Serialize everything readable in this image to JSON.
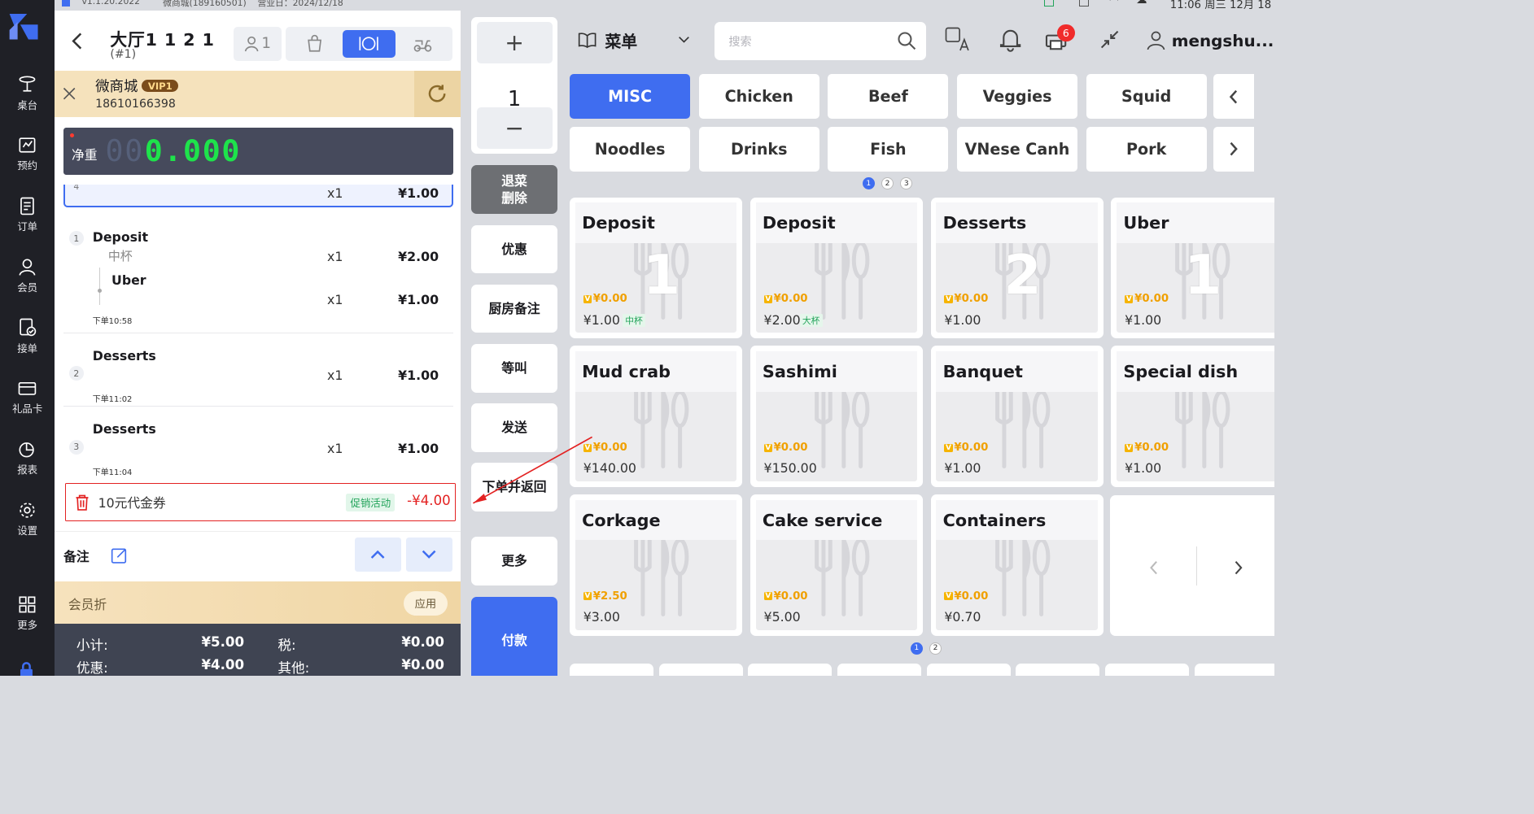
{
  "app": {
    "version": "v1.1.20.2022",
    "store": "微商城(189160501)",
    "business_day": "营业日：2024/12/18"
  },
  "sidebar": {
    "items": [
      {
        "label": "桌台",
        "icon": "table-icon"
      },
      {
        "label": "预约",
        "icon": "reservation-icon"
      },
      {
        "label": "订单",
        "icon": "order-icon"
      },
      {
        "label": "会员",
        "icon": "member-icon"
      },
      {
        "label": "接单",
        "icon": "accept-order-icon"
      },
      {
        "label": "礼品卡",
        "icon": "gift-card-icon"
      },
      {
        "label": "报表",
        "icon": "report-icon"
      },
      {
        "label": "设置",
        "icon": "settings-icon"
      },
      {
        "label": "更多",
        "icon": "more-icon"
      }
    ]
  },
  "order": {
    "table": "大厅1 1 2 1",
    "sub": "(#1)",
    "guests": "1",
    "member": {
      "name": "微商城",
      "level": "VIP1",
      "phone": "18610166398"
    },
    "scale": {
      "label": "净重",
      "ghost": "00",
      "value": "0.000"
    },
    "items": [
      {
        "num": "4",
        "qty": "x1",
        "price": "¥1.00"
      },
      {
        "num": "1",
        "name": "Deposit",
        "variant": "中杯",
        "qty": "x1",
        "price": "¥2.00",
        "sub": {
          "name": "Uber",
          "qty": "x1",
          "price": "¥1.00"
        },
        "time": "下单10:58"
      },
      {
        "num": "2",
        "name": "Desserts",
        "qty": "x1",
        "price": "¥1.00",
        "time": "下单11:02"
      },
      {
        "num": "3",
        "name": "Desserts",
        "qty": "x1",
        "price": "¥1.00",
        "time": "下单11:04"
      }
    ],
    "coupon": {
      "text": "10元代金券",
      "tag": "促销活动",
      "amount": "-¥4.00"
    },
    "note_label": "备注",
    "member_discount": {
      "label": "会员折",
      "apply": "应用"
    },
    "totals": {
      "subtotal_label": "小计:",
      "subtotal": "¥5.00",
      "tax_label": "税:",
      "tax": "¥0.00",
      "discount_label": "优惠:",
      "discount": "¥4.00",
      "other_label": "其他:",
      "other": "¥0.00"
    }
  },
  "actions": {
    "plus": "+",
    "qty": "1",
    "minus": "−",
    "return": "退菜\n删除",
    "promo": "优惠",
    "kitchen_note": "厨房备注",
    "hold": "等叫",
    "send": "发送",
    "order_return": "下单并返回",
    "more": "更多",
    "pay": "付款"
  },
  "menu": {
    "title": "菜单",
    "search_placeholder": "搜索",
    "notification_count": "6",
    "user": "mengshu...",
    "status_time": "11:06 周三 12月 18",
    "categories_row1": [
      "MISC",
      "Chicken",
      "Beef",
      "Veggies",
      "Squid"
    ],
    "categories_row2": [
      "Noodles",
      "Drinks",
      "Fish",
      "VNese Canh",
      "Pork"
    ],
    "active_category": "MISC",
    "cat_pages": [
      "1",
      "2",
      "3"
    ],
    "dishes": [
      {
        "name": "Deposit",
        "count": "1",
        "vip": "¥0.00",
        "price": "¥1.00",
        "size": "中杯"
      },
      {
        "name": "Deposit",
        "count": "",
        "vip": "¥0.00",
        "price": "¥2.00",
        "size": "大杯"
      },
      {
        "name": "Desserts",
        "count": "2",
        "vip": "¥0.00",
        "price": "¥1.00",
        "size": ""
      },
      {
        "name": "Uber",
        "count": "1",
        "vip": "¥0.00",
        "price": "¥1.00",
        "size": ""
      },
      {
        "name": "Mud crab",
        "count": "",
        "vip": "¥0.00",
        "price": "¥140.00",
        "size": ""
      },
      {
        "name": "Sashimi",
        "count": "",
        "vip": "¥0.00",
        "price": "¥150.00",
        "size": ""
      },
      {
        "name": "Banquet",
        "count": "",
        "vip": "¥0.00",
        "price": "¥1.00",
        "size": ""
      },
      {
        "name": "Special dish",
        "count": "",
        "vip": "¥0.00",
        "price": "¥1.00",
        "size": ""
      },
      {
        "name": "Corkage",
        "count": "",
        "vip": "¥2.50",
        "price": "¥3.00",
        "size": ""
      },
      {
        "name": "Cake service",
        "count": "",
        "vip": "¥0.00",
        "price": "¥5.00",
        "size": ""
      },
      {
        "name": "Containers",
        "count": "",
        "vip": "¥0.00",
        "price": "¥0.70",
        "size": ""
      }
    ],
    "dish_pages": [
      "1",
      "2"
    ],
    "vip_tag": "V"
  },
  "colors": {
    "accent": "#3f6df0",
    "sidebar": "#1f2026",
    "member_bar": "#f5e2bc",
    "highlight": "#e32222"
  }
}
